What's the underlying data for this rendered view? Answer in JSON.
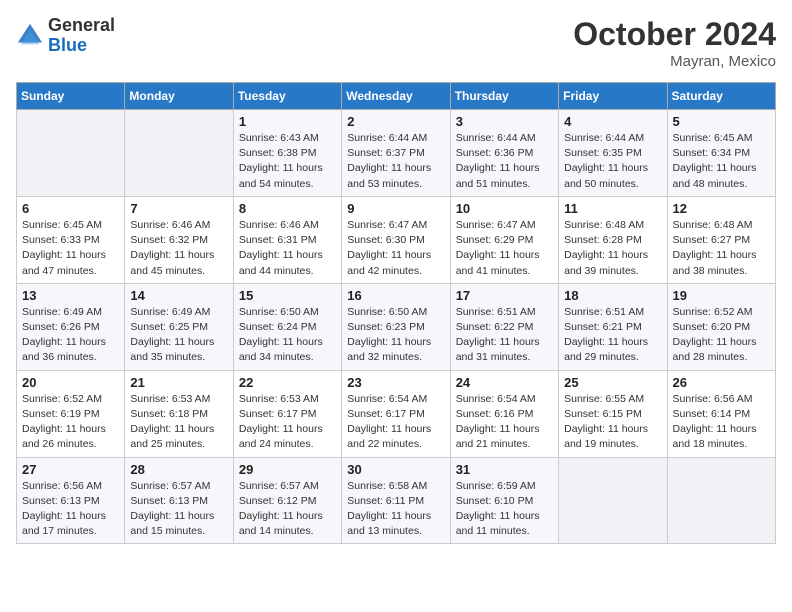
{
  "header": {
    "logo_general": "General",
    "logo_blue": "Blue",
    "month": "October 2024",
    "location": "Mayran, Mexico"
  },
  "weekdays": [
    "Sunday",
    "Monday",
    "Tuesday",
    "Wednesday",
    "Thursday",
    "Friday",
    "Saturday"
  ],
  "weeks": [
    [
      {
        "day": "",
        "info": ""
      },
      {
        "day": "",
        "info": ""
      },
      {
        "day": "1",
        "info": "Sunrise: 6:43 AM\nSunset: 6:38 PM\nDaylight: 11 hours and 54 minutes."
      },
      {
        "day": "2",
        "info": "Sunrise: 6:44 AM\nSunset: 6:37 PM\nDaylight: 11 hours and 53 minutes."
      },
      {
        "day": "3",
        "info": "Sunrise: 6:44 AM\nSunset: 6:36 PM\nDaylight: 11 hours and 51 minutes."
      },
      {
        "day": "4",
        "info": "Sunrise: 6:44 AM\nSunset: 6:35 PM\nDaylight: 11 hours and 50 minutes."
      },
      {
        "day": "5",
        "info": "Sunrise: 6:45 AM\nSunset: 6:34 PM\nDaylight: 11 hours and 48 minutes."
      }
    ],
    [
      {
        "day": "6",
        "info": "Sunrise: 6:45 AM\nSunset: 6:33 PM\nDaylight: 11 hours and 47 minutes."
      },
      {
        "day": "7",
        "info": "Sunrise: 6:46 AM\nSunset: 6:32 PM\nDaylight: 11 hours and 45 minutes."
      },
      {
        "day": "8",
        "info": "Sunrise: 6:46 AM\nSunset: 6:31 PM\nDaylight: 11 hours and 44 minutes."
      },
      {
        "day": "9",
        "info": "Sunrise: 6:47 AM\nSunset: 6:30 PM\nDaylight: 11 hours and 42 minutes."
      },
      {
        "day": "10",
        "info": "Sunrise: 6:47 AM\nSunset: 6:29 PM\nDaylight: 11 hours and 41 minutes."
      },
      {
        "day": "11",
        "info": "Sunrise: 6:48 AM\nSunset: 6:28 PM\nDaylight: 11 hours and 39 minutes."
      },
      {
        "day": "12",
        "info": "Sunrise: 6:48 AM\nSunset: 6:27 PM\nDaylight: 11 hours and 38 minutes."
      }
    ],
    [
      {
        "day": "13",
        "info": "Sunrise: 6:49 AM\nSunset: 6:26 PM\nDaylight: 11 hours and 36 minutes."
      },
      {
        "day": "14",
        "info": "Sunrise: 6:49 AM\nSunset: 6:25 PM\nDaylight: 11 hours and 35 minutes."
      },
      {
        "day": "15",
        "info": "Sunrise: 6:50 AM\nSunset: 6:24 PM\nDaylight: 11 hours and 34 minutes."
      },
      {
        "day": "16",
        "info": "Sunrise: 6:50 AM\nSunset: 6:23 PM\nDaylight: 11 hours and 32 minutes."
      },
      {
        "day": "17",
        "info": "Sunrise: 6:51 AM\nSunset: 6:22 PM\nDaylight: 11 hours and 31 minutes."
      },
      {
        "day": "18",
        "info": "Sunrise: 6:51 AM\nSunset: 6:21 PM\nDaylight: 11 hours and 29 minutes."
      },
      {
        "day": "19",
        "info": "Sunrise: 6:52 AM\nSunset: 6:20 PM\nDaylight: 11 hours and 28 minutes."
      }
    ],
    [
      {
        "day": "20",
        "info": "Sunrise: 6:52 AM\nSunset: 6:19 PM\nDaylight: 11 hours and 26 minutes."
      },
      {
        "day": "21",
        "info": "Sunrise: 6:53 AM\nSunset: 6:18 PM\nDaylight: 11 hours and 25 minutes."
      },
      {
        "day": "22",
        "info": "Sunrise: 6:53 AM\nSunset: 6:17 PM\nDaylight: 11 hours and 24 minutes."
      },
      {
        "day": "23",
        "info": "Sunrise: 6:54 AM\nSunset: 6:17 PM\nDaylight: 11 hours and 22 minutes."
      },
      {
        "day": "24",
        "info": "Sunrise: 6:54 AM\nSunset: 6:16 PM\nDaylight: 11 hours and 21 minutes."
      },
      {
        "day": "25",
        "info": "Sunrise: 6:55 AM\nSunset: 6:15 PM\nDaylight: 11 hours and 19 minutes."
      },
      {
        "day": "26",
        "info": "Sunrise: 6:56 AM\nSunset: 6:14 PM\nDaylight: 11 hours and 18 minutes."
      }
    ],
    [
      {
        "day": "27",
        "info": "Sunrise: 6:56 AM\nSunset: 6:13 PM\nDaylight: 11 hours and 17 minutes."
      },
      {
        "day": "28",
        "info": "Sunrise: 6:57 AM\nSunset: 6:13 PM\nDaylight: 11 hours and 15 minutes."
      },
      {
        "day": "29",
        "info": "Sunrise: 6:57 AM\nSunset: 6:12 PM\nDaylight: 11 hours and 14 minutes."
      },
      {
        "day": "30",
        "info": "Sunrise: 6:58 AM\nSunset: 6:11 PM\nDaylight: 11 hours and 13 minutes."
      },
      {
        "day": "31",
        "info": "Sunrise: 6:59 AM\nSunset: 6:10 PM\nDaylight: 11 hours and 11 minutes."
      },
      {
        "day": "",
        "info": ""
      },
      {
        "day": "",
        "info": ""
      }
    ]
  ]
}
